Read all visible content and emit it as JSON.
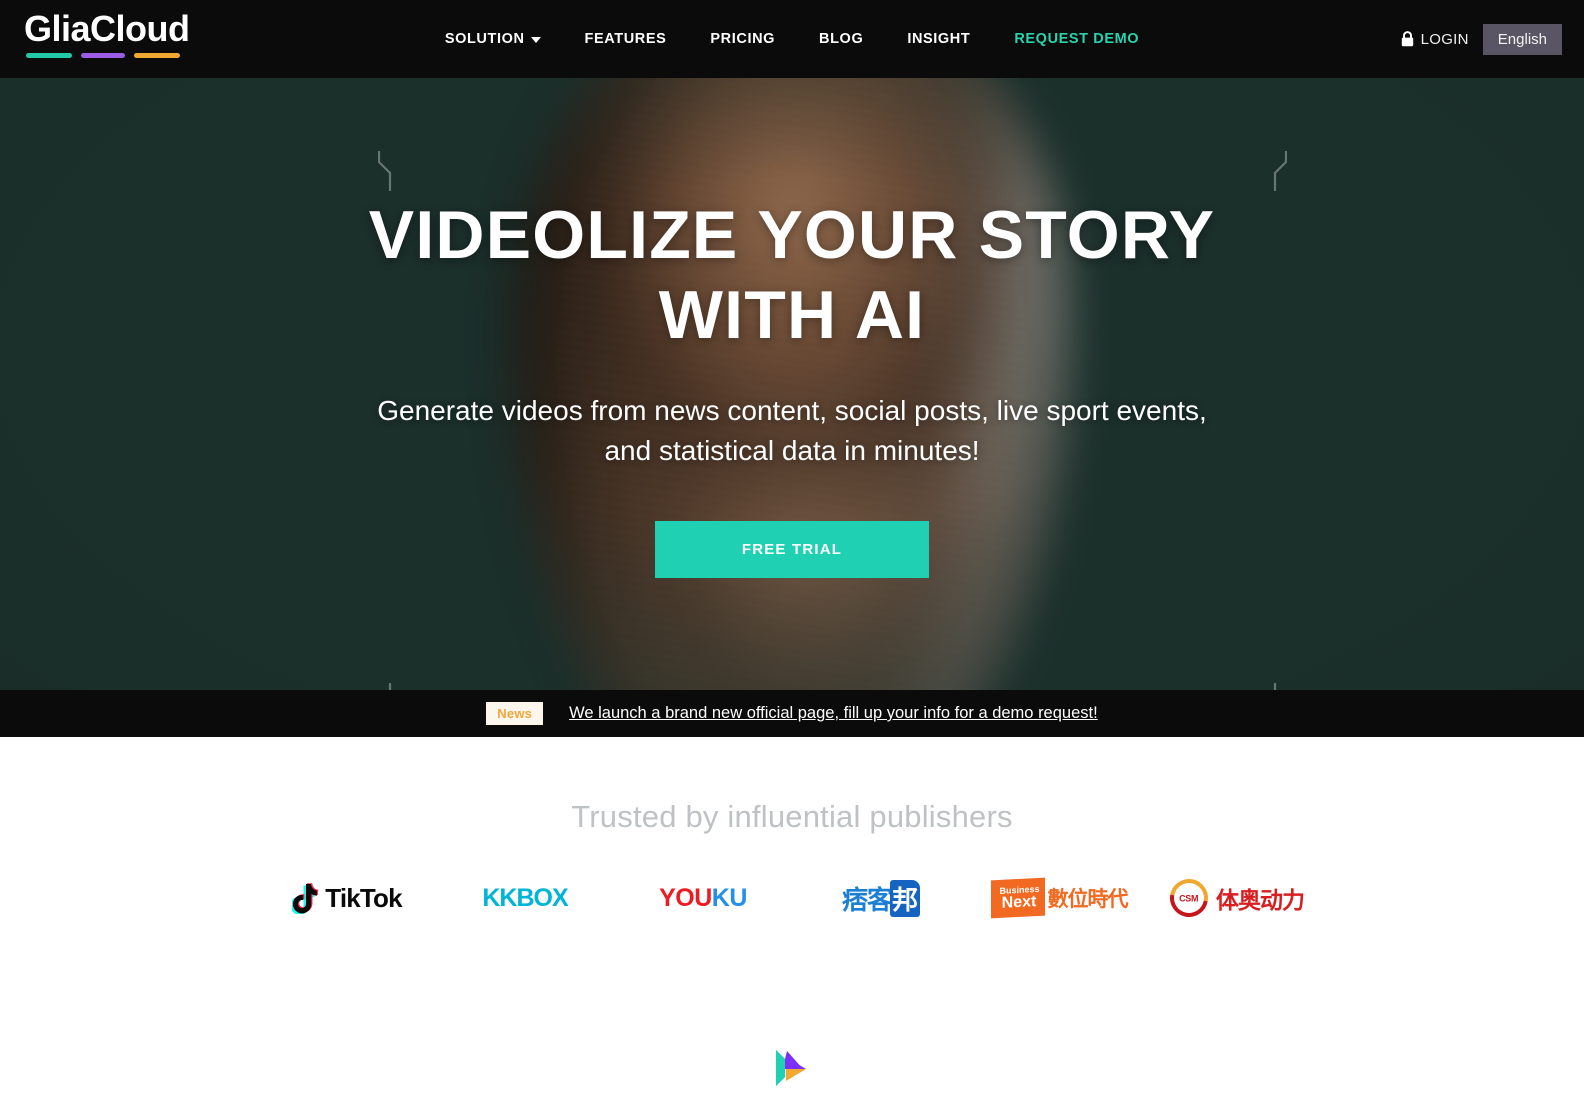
{
  "brand": {
    "name": "GliaCloud",
    "bar_colors": [
      "#22c9a8",
      "#9b5de5",
      "#f0a830"
    ]
  },
  "nav": {
    "items": [
      {
        "label": "SOLUTION",
        "has_caret": true,
        "accent": false,
        "icon": "chevron-down-icon"
      },
      {
        "label": "FEATURES",
        "has_caret": false,
        "accent": false
      },
      {
        "label": "PRICING",
        "has_caret": false,
        "accent": false
      },
      {
        "label": "BLOG",
        "has_caret": false,
        "accent": false
      },
      {
        "label": "INSIGHT",
        "has_caret": false,
        "accent": false
      },
      {
        "label": "REQUEST DEMO",
        "has_caret": false,
        "accent": true
      }
    ],
    "login_label": "LOGIN",
    "login_icon": "lock-icon",
    "language_label": "English",
    "accent_color": "#2ad3ae",
    "bar_background": "#0b0b0b"
  },
  "hero": {
    "headline_line1": "VIDEOLIZE YOUR STORY",
    "headline_line2": "WITH AI",
    "subhead_line1": "Generate videos from news content, social posts, live sport events,",
    "subhead_line2": "and statistical data in minutes!",
    "cta_label": "FREE TRIAL",
    "cta_color": "#1fd1b2",
    "background_color": "#1b2f2b"
  },
  "news": {
    "badge": "News",
    "badge_color": "#f0a63c",
    "message": "We launch a brand new official page, fill up your info for a demo request!"
  },
  "trusted": {
    "title": "Trusted by influential publishers",
    "logos": [
      {
        "name": "tiktok",
        "text": "TikTok"
      },
      {
        "name": "kkbox",
        "text": "KKBOX"
      },
      {
        "name": "youku",
        "text_red": "YOU",
        "text_blue": "KU"
      },
      {
        "name": "pixnet",
        "text": "痞客",
        "text_chip": "邦"
      },
      {
        "name": "business-next",
        "small": "Business",
        "big": "Next",
        "cn": "數位時代"
      },
      {
        "name": "csm",
        "mark": "CSM",
        "cn": "体奥动力"
      }
    ]
  },
  "footer": {
    "logo_icon": "play-logo-icon"
  }
}
